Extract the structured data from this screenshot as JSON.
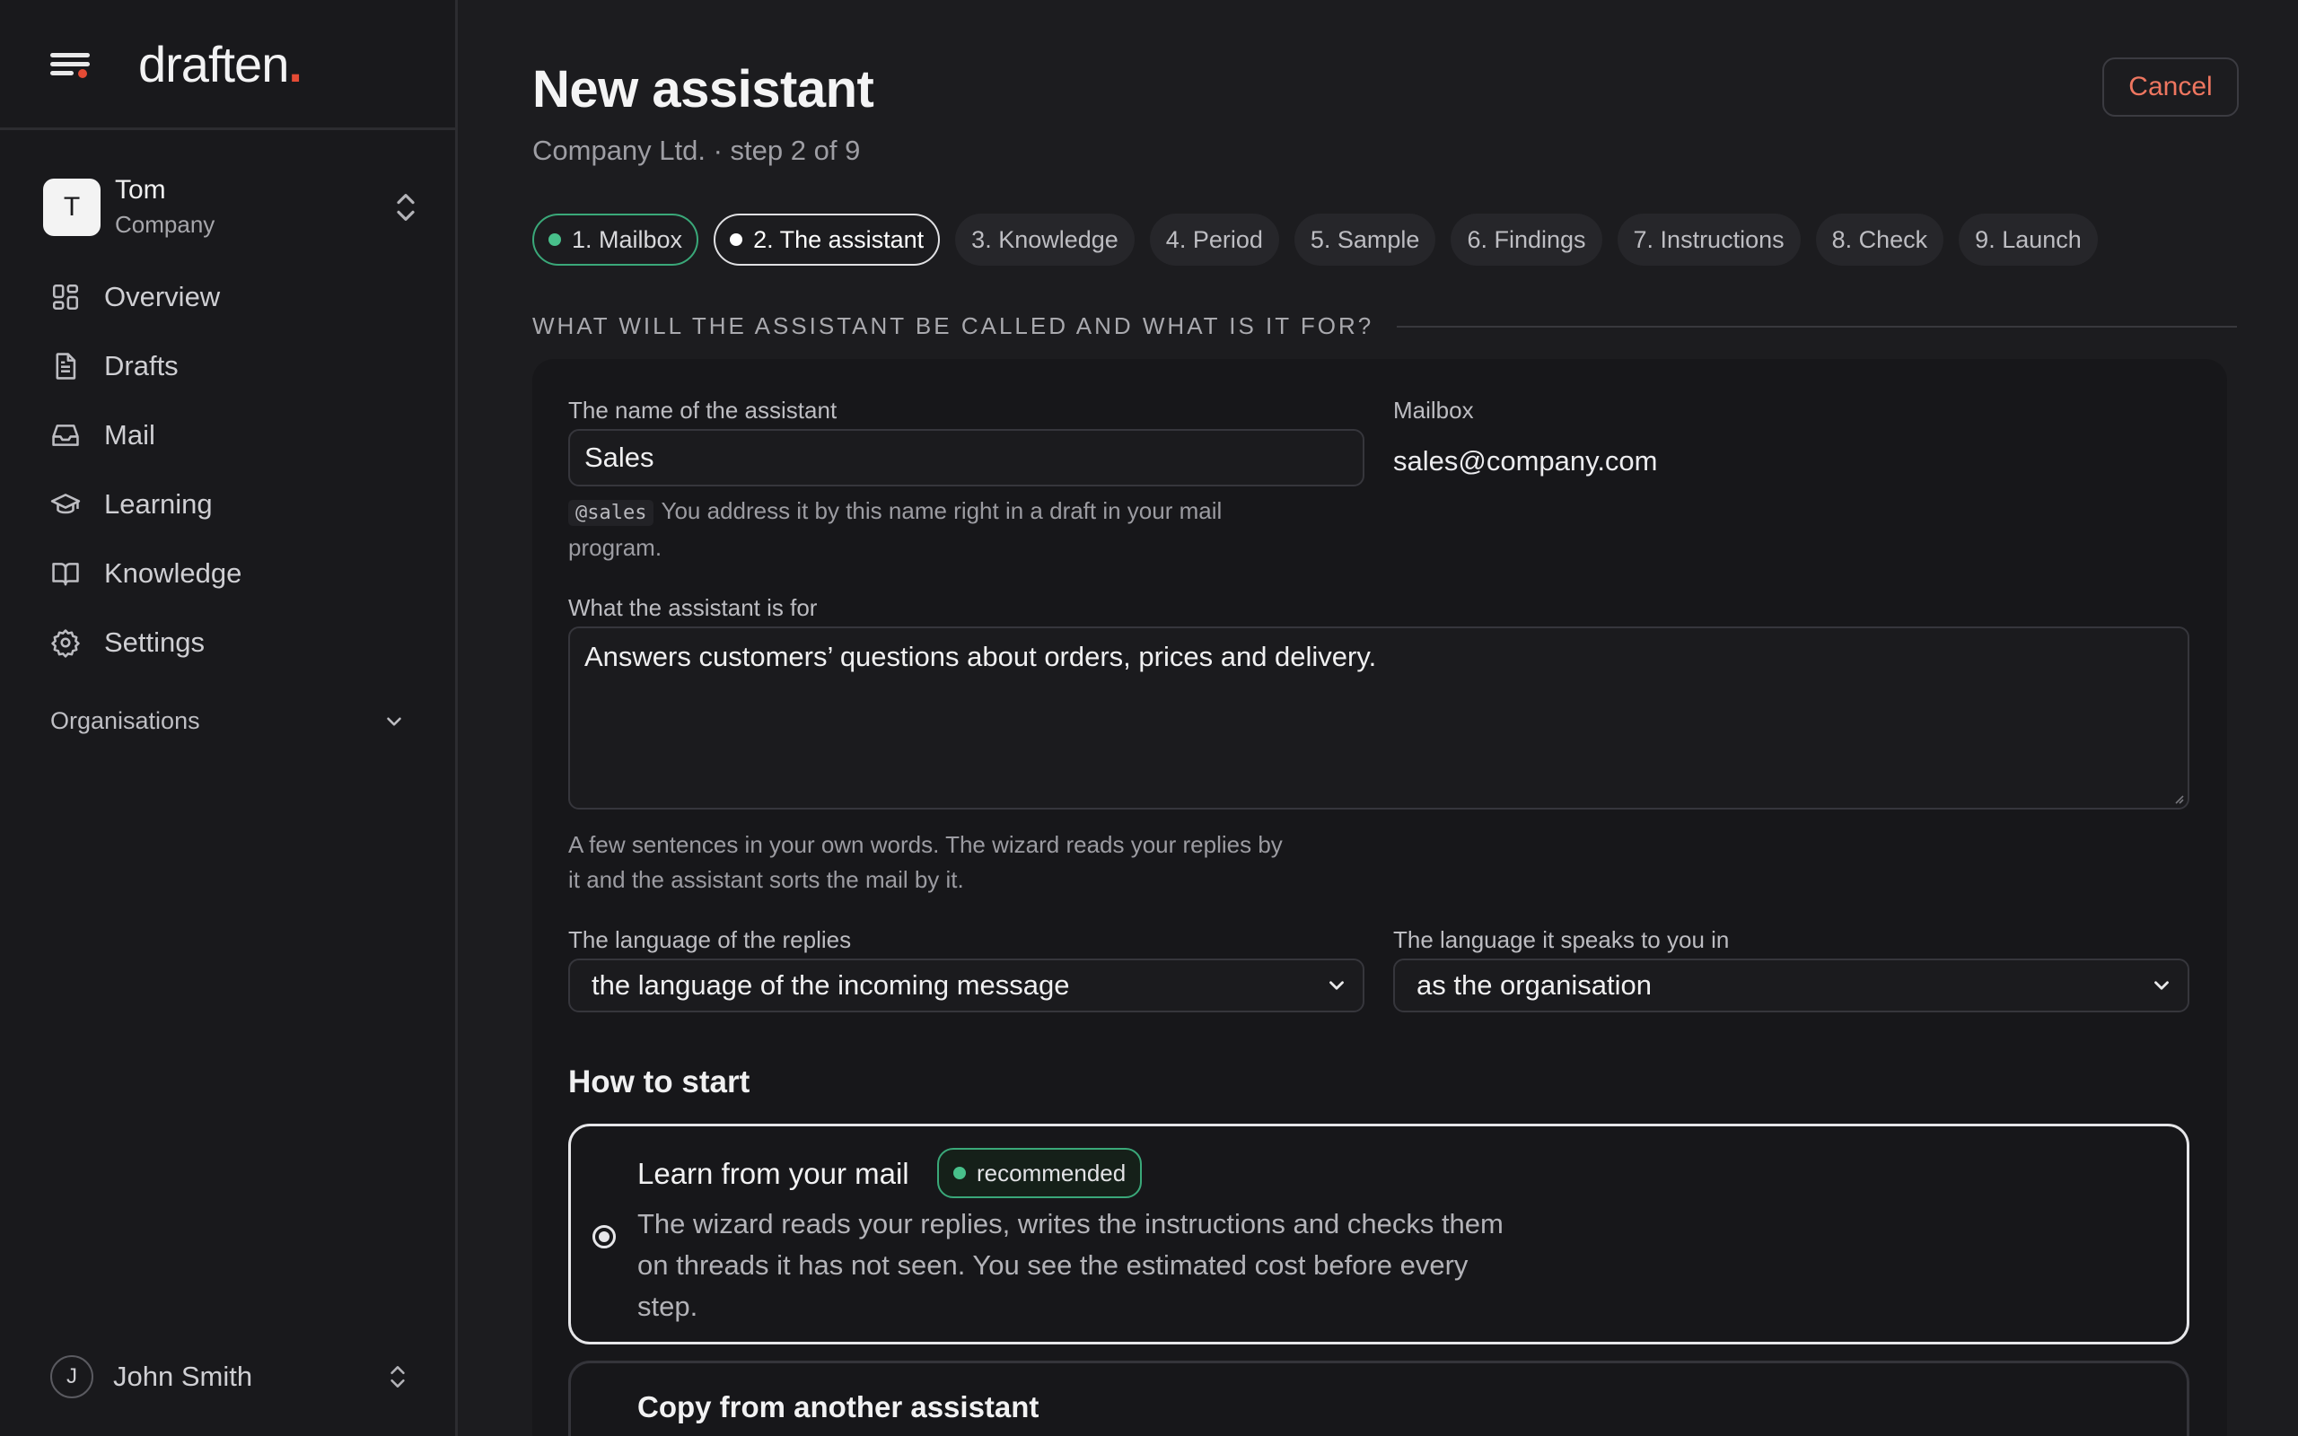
{
  "brand": {
    "name": "draften",
    "dot": "."
  },
  "account": {
    "initial": "T",
    "name": "Tom",
    "org": "Company"
  },
  "nav": [
    {
      "label": "Overview",
      "icon": "grid-icon"
    },
    {
      "label": "Drafts",
      "icon": "document-icon"
    },
    {
      "label": "Mail",
      "icon": "inbox-icon"
    },
    {
      "label": "Learning",
      "icon": "graduation-cap-icon"
    },
    {
      "label": "Knowledge",
      "icon": "book-icon"
    },
    {
      "label": "Settings",
      "icon": "gear-icon"
    }
  ],
  "organisations_label": "Organisations",
  "user": {
    "initial": "J",
    "name": "John Smith"
  },
  "page": {
    "title": "New assistant",
    "subtitle": "Company Ltd. · step 2 of 9",
    "cancel": "Cancel"
  },
  "steps": [
    {
      "label": "1. Mailbox",
      "state": "done"
    },
    {
      "label": "2. The assistant",
      "state": "active"
    },
    {
      "label": "3. Knowledge",
      "state": "todo"
    },
    {
      "label": "4. Period",
      "state": "todo"
    },
    {
      "label": "5. Sample",
      "state": "todo"
    },
    {
      "label": "6. Findings",
      "state": "todo"
    },
    {
      "label": "7. Instructions",
      "state": "todo"
    },
    {
      "label": "8. Check",
      "state": "todo"
    },
    {
      "label": "9. Launch",
      "state": "todo"
    }
  ],
  "section_title": "WHAT WILL THE ASSISTANT BE CALLED AND WHAT IS IT FOR?",
  "form": {
    "name_label": "The name of the assistant",
    "name_value": "Sales",
    "handle": "@sales",
    "name_hint": "You address it by this name right in a draft in your mail",
    "name_hint_2": "program.",
    "mailbox_label": "Mailbox",
    "mailbox_value": "sales@company.com",
    "purpose_label": "What the assistant is for",
    "purpose_value": "Answers customers’ questions about orders, prices and delivery.",
    "purpose_hint_1": "A few sentences in your own words. The wizard reads your replies by",
    "purpose_hint_2": "it and the assistant sorts the mail by it.",
    "reply_lang_label": "The language of the replies",
    "reply_lang_value": "the language of the incoming message",
    "speak_lang_label": "The language it speaks to you in",
    "speak_lang_value": "as the organisation"
  },
  "start": {
    "heading": "How to start",
    "option1_title": "Learn from your mail",
    "option1_badge": "recommended",
    "option1_desc_1": "The wizard reads your replies, writes the instructions and checks them",
    "option1_desc_2": "on threads it has not seen. You see the estimated cost before every",
    "option1_desc_3": "step.",
    "option2_title": "Copy from another assistant"
  },
  "colors": {
    "accent_red": "#e54b35",
    "accent_green": "#48c08b",
    "cancel_text": "#ee7660"
  }
}
